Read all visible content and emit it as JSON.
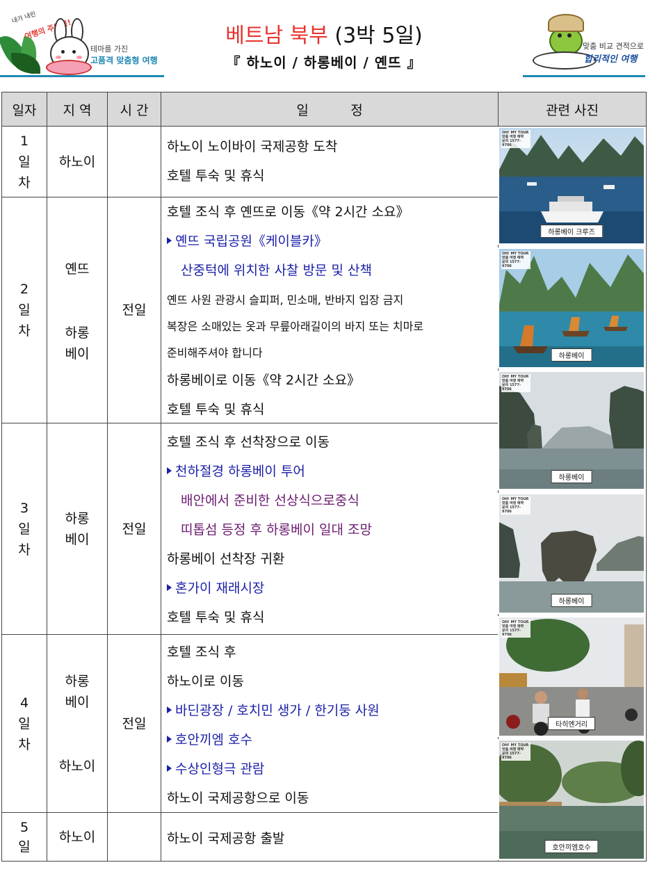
{
  "header": {
    "title_red": "베트남 북부",
    "title_black": "(3박 5일)",
    "subtitle": "『 하노이 / 하롱베이 / 옌뜨 』",
    "left_logo": {
      "tag_small": "내가 내린",
      "tag_red": "여행의 주인공!",
      "line1": "테마를 가진",
      "line2": "고품격 맞춤형 여행"
    },
    "right_logo": {
      "line1": "맞춤 비교 견적으로",
      "line2": "합리적인 여행"
    }
  },
  "table": {
    "headers": [
      "일자",
      "지 역",
      "시 간",
      "일          정",
      "관련 사진"
    ],
    "rows": [
      {
        "day": [
          "1",
          "일",
          "차"
        ],
        "region": [
          "하노이"
        ],
        "time": "",
        "schedule": [
          {
            "text": "하노이 노이바이 국제공항 도착",
            "style": "normal"
          },
          {
            "text": "호텔 투숙 및 휴식",
            "style": "normal"
          }
        ]
      },
      {
        "day": [
          "2",
          "일",
          "차"
        ],
        "region": [
          "옌뜨",
          "",
          "하롱",
          "베이"
        ],
        "time": "전일",
        "schedule": [
          {
            "text": "호텔 조식 후 옌뜨로 이동《약 2시간 소요》",
            "style": "normal"
          },
          {
            "text": "옌뜨 국립공원《케이블카》",
            "style": "blue-bullet"
          },
          {
            "text": "산중턱에 위치한 사찰 방문 및 산책",
            "style": "blue-indent"
          },
          {
            "text": "옌뜨 사원 관광시 슬피퍼, 민소매, 반바지 입장 금지",
            "style": "small"
          },
          {
            "text": "복장은 소매있는 옷과 무릎아래길이의 바지 또는 치마로",
            "style": "small"
          },
          {
            "text": "준비해주셔야 합니다",
            "style": "small"
          },
          {
            "text": "하롱베이로 이동《약 2시간 소요》",
            "style": "normal"
          },
          {
            "text": "호텔 투숙 및 휴식",
            "style": "normal"
          }
        ]
      },
      {
        "day": [
          "3",
          "일",
          "차"
        ],
        "region": [
          "하롱",
          "베이"
        ],
        "time": "전일",
        "schedule": [
          {
            "text": "호텔 조식 후 선착장으로 이동",
            "style": "normal"
          },
          {
            "text": "천하절경 하롱베이 투어",
            "style": "blue-bullet"
          },
          {
            "text": "배안에서 준비한 선상식으로중식",
            "style": "purple-indent"
          },
          {
            "text": "띠톱섬 등정 후 하롱베이 일대 조망",
            "style": "purple-indent"
          },
          {
            "text": "하롱베이 선착장 귀환",
            "style": "normal"
          },
          {
            "text": "혼가이 재래시장",
            "style": "blue-bullet"
          },
          {
            "text": "호텔 투숙 및 휴식",
            "style": "normal"
          }
        ]
      },
      {
        "day": [
          "4",
          "일",
          "차"
        ],
        "region": [
          "하롱",
          "베이",
          "",
          "하노이"
        ],
        "time": "전일",
        "schedule": [
          {
            "text": "호텔 조식 후",
            "style": "normal"
          },
          {
            "text": "하노이로 이동",
            "style": "normal"
          },
          {
            "text": "바딘광장 / 호치민 생가 / 한기둥 사원",
            "style": "blue-bullet"
          },
          {
            "text": "호안끼엠 호수",
            "style": "blue-bullet"
          },
          {
            "text": "수상인형극 관람",
            "style": "blue-bullet"
          },
          {
            "text": "하노이 국제공항으로 이동",
            "style": "normal"
          }
        ]
      },
      {
        "day": [
          "5",
          "일"
        ],
        "region": [
          "하노이"
        ],
        "time": "",
        "schedule": [
          {
            "text": "하노이 국제공항 출발",
            "style": "normal"
          }
        ]
      }
    ]
  },
  "photos": [
    {
      "caption": "하롱베이 크루즈",
      "icon": "cruise-ship-photo"
    },
    {
      "caption": "하롱베이",
      "icon": "junk-boats-photo"
    },
    {
      "caption": "하롱베이",
      "icon": "karst-islands-photo"
    },
    {
      "caption": "하롱베이",
      "icon": "rock-island-photo"
    },
    {
      "caption": "타히엔거리",
      "icon": "street-motorbikes-photo"
    },
    {
      "caption": "호안끼엠호수",
      "icon": "lake-trees-photo"
    }
  ],
  "photo_brand": {
    "name": "OH! MY TOUR",
    "sub": "맞춤 여행 예약",
    "phone": "문의 1577-9706"
  },
  "colors": {
    "title_red": "#e8322d",
    "header_bg": "#d9d9d9",
    "schedule_blue": "#1a1fa8",
    "schedule_purple": "#6a1b6e",
    "logo_blue": "#1e88b4"
  }
}
